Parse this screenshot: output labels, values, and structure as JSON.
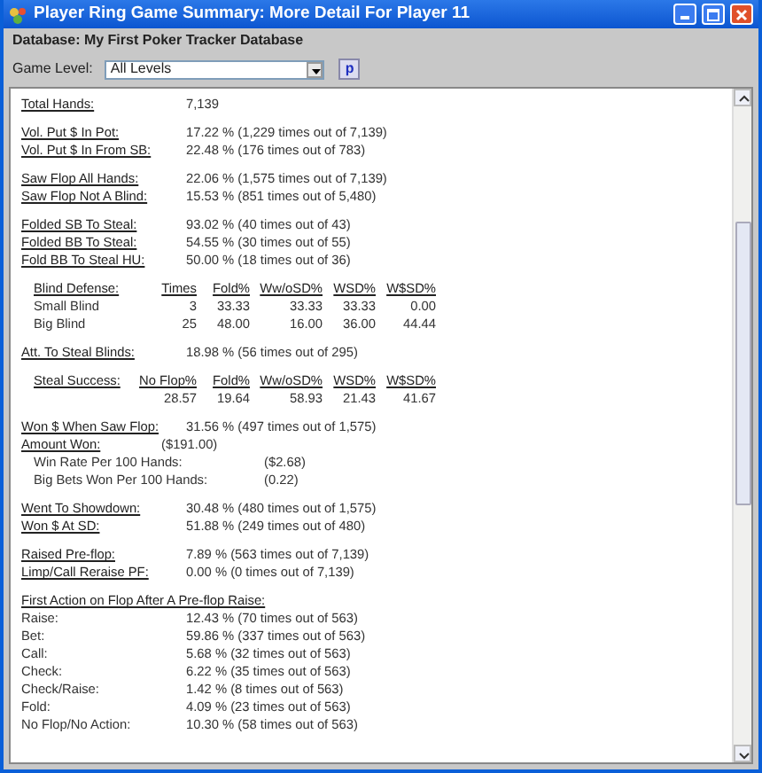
{
  "window": {
    "title": "Player Ring Game Summary: More Detail For Player 11"
  },
  "database": "Database: My First Poker Tracker Database",
  "game_level": {
    "label": "Game Level:",
    "value": "All Levels",
    "button": "p"
  },
  "sections": [
    {
      "kind": "stats",
      "rows": [
        {
          "kind": "link",
          "label": "Total Hands:",
          "value": "7,139"
        }
      ]
    },
    {
      "kind": "stats",
      "rows": [
        {
          "kind": "link",
          "label": "Vol. Put $ In Pot:",
          "value": "17.22 % (1,229 times out of 7,139)"
        },
        {
          "kind": "link",
          "label": "Vol. Put $ In From SB:",
          "value": "22.48 % (176 times out of 783)"
        }
      ]
    },
    {
      "kind": "stats",
      "rows": [
        {
          "kind": "link",
          "label": "Saw Flop All Hands:",
          "value": "22.06 % (1,575 times out of 7,139)"
        },
        {
          "kind": "link",
          "label": "Saw Flop Not A Blind:",
          "value": "15.53 % (851 times out of 5,480)"
        }
      ]
    },
    {
      "kind": "stats",
      "rows": [
        {
          "kind": "link",
          "label": "Folded SB To Steal:",
          "value": "93.02 % (40 times out of 43)"
        },
        {
          "kind": "link",
          "label": "Folded BB To Steal:",
          "value": "54.55 % (30 times out of 55)"
        },
        {
          "kind": "link",
          "label": "Fold BB To Steal HU:",
          "value": "50.00 % (18 times out of 36)"
        }
      ]
    },
    {
      "kind": "table",
      "columns": [
        "Blind Defense:",
        "Times",
        "Fold%",
        "Ww/oSD%",
        "WSD%",
        "W$SD%"
      ],
      "rows": [
        [
          "Small Blind",
          "3",
          "33.33",
          "33.33",
          "33.33",
          "0.00"
        ],
        [
          "Big Blind",
          "25",
          "48.00",
          "16.00",
          "36.00",
          "44.44"
        ]
      ]
    },
    {
      "kind": "stats",
      "rows": [
        {
          "kind": "link",
          "label": "Att. To Steal Blinds:",
          "value": "18.98 % (56 times out of 295)"
        }
      ]
    },
    {
      "kind": "table",
      "columns": [
        "Steal Success:",
        "No Flop%",
        "Fold%",
        "Ww/oSD%",
        "WSD%",
        "W$SD%"
      ],
      "rows": [
        [
          "",
          "28.57",
          "19.64",
          "58.93",
          "21.43",
          "41.67"
        ]
      ]
    },
    {
      "kind": "stats",
      "rows": [
        {
          "kind": "link",
          "label": "Won $ When Saw Flop:",
          "value": "31.56 % (497 times out of 1,575)"
        },
        {
          "kind": "short",
          "label": "Amount Won:",
          "value": "($191.00)"
        },
        {
          "kind": "sub",
          "label": "Win Rate Per 100 Hands:",
          "value": "($2.68)"
        },
        {
          "kind": "sub",
          "label": "Big Bets Won Per 100 Hands:",
          "value": "(0.22)"
        }
      ]
    },
    {
      "kind": "stats",
      "rows": [
        {
          "kind": "link",
          "label": "Went To Showdown:",
          "value": "30.48 % (480 times out of 1,575)"
        },
        {
          "kind": "link",
          "label": "Won $ At SD:",
          "value": "51.88 % (249 times out of 480)"
        }
      ]
    },
    {
      "kind": "stats",
      "rows": [
        {
          "kind": "link",
          "label": "Raised Pre-flop:",
          "value": "7.89 % (563 times out of 7,139)"
        },
        {
          "kind": "link",
          "label": "Limp/Call Reraise PF:",
          "value": "0.00 % (0 times out of 7,139)"
        }
      ]
    },
    {
      "kind": "stats",
      "rows": [
        {
          "kind": "heading",
          "label": "First Action on Flop After A Pre-flop Raise:"
        },
        {
          "kind": "plain",
          "label": "Raise:",
          "value": "12.43 % (70 times out of 563)"
        },
        {
          "kind": "plain",
          "label": "Bet:",
          "value": "59.86 % (337 times out of 563)"
        },
        {
          "kind": "plain",
          "label": "Call:",
          "value": "5.68 % (32 times out of 563)"
        },
        {
          "kind": "plain",
          "label": "Check:",
          "value": "6.22 % (35 times out of 563)"
        },
        {
          "kind": "plain",
          "label": "Check/Raise:",
          "value": "1.42 % (8 times out of 563)"
        },
        {
          "kind": "plain",
          "label": "Fold:",
          "value": "4.09 % (23 times out of 563)"
        },
        {
          "kind": "plain",
          "label": "No Flop/No Action:",
          "value": "10.30 % (58 times out of 563)"
        }
      ]
    }
  ]
}
